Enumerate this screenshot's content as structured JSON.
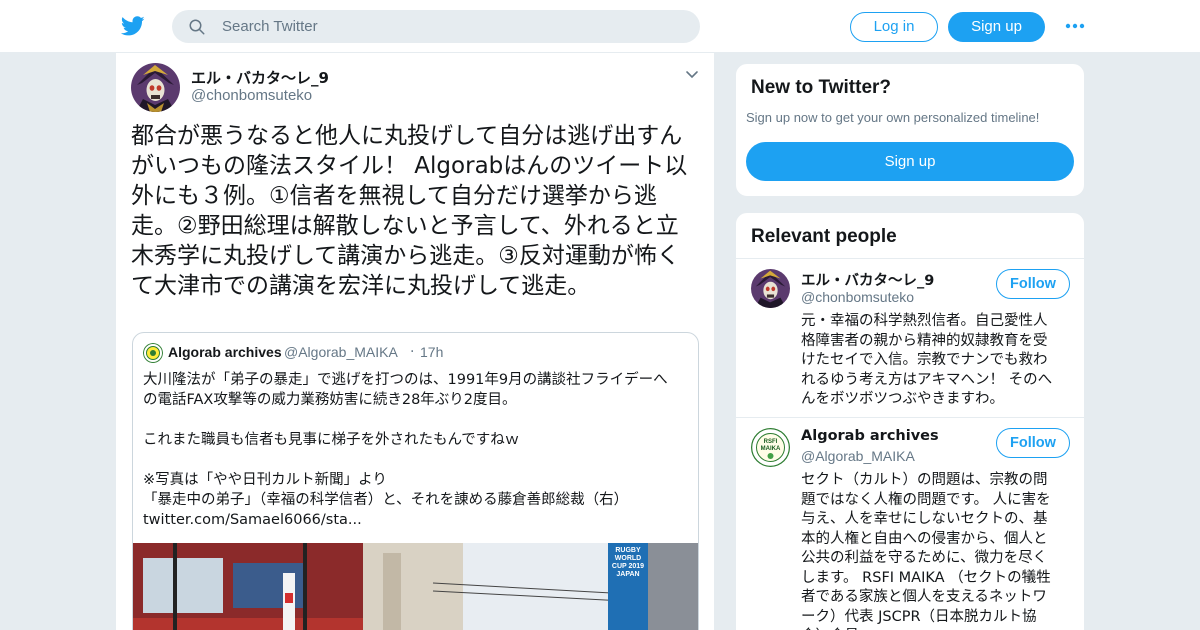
{
  "nav": {
    "search_placeholder": "Search Twitter",
    "login_label": "Log in",
    "signup_label": "Sign up",
    "more_icon": "more-dots-icon"
  },
  "tweet": {
    "author_name": "エル・バカタ～レ_9",
    "author_handle": "@chonbomsuteko",
    "text": "都合が悪うなると他人に丸投げして自分は逃げ出すんがいつもの隆法スタイル！ Algorabはんのツイート以外にも３例。①信者を無視して自分だけ選挙から逃走。②野田総理は解散しないと予言して、外れると立木秀学に丸投げして講演から逃走。③反対運動が怖くて大津市での講演を宏洋に丸投げして逃走。",
    "quote": {
      "name": "Algorab archives",
      "handle": "@Algorab_MAIKA",
      "dot": "·",
      "time": "17h",
      "lines": [
        "大川隆法が「弟子の暴走」で逃げを打つのは、1991年9月の講談社フライデーへ",
        "の電話FAX攻撃等の威力業務妨害に続き28年ぶり2度目。",
        "",
        "これまた職員も信者も見事に梯子を外されたもんですねｗ",
        "",
        "※写真は「やや日刊カルト新聞」より",
        "「暴走中の弟子」（幸福の科学信者）と、それを諌める藤倉善郎総裁（右）",
        "twitter.com/Samael6066/sta..."
      ],
      "photo_banner": "RUGBY WORLD CUP 2019 JAPAN"
    }
  },
  "sidebar": {
    "new_title": "New to Twitter?",
    "new_sub": "Sign up now to get your own personalized timeline!",
    "new_signup": "Sign up",
    "relevant_title": "Relevant people",
    "people": [
      {
        "name": "エル・バカタ～レ_9",
        "handle": "@chonbomsuteko",
        "follow": "Follow",
        "bio": "元・幸福の科学熱烈信者。自己愛性人\n格障害者の親から精神的奴隷教育を受\nけたセイで入信。宗教でナンでも救わ\nれるゆう考え方はアキマヘン！ そのへ\nんをボツボツつぶやきますわ。"
      },
      {
        "name": "Algorab archives",
        "handle": "@Algorab_MAIKA",
        "follow": "Follow",
        "bio": "セクト（カルト）の問題は、宗教の問\n題ではなく人権の問題です。 人に害を\n与え、人を幸せにしないセクトの、基\n本的人権と自由への侵害から、個人と\n公共の利益を守るために、微力を尽く\nします。 RSFI MAIKA （セクトの犠牲\n者である家族と個人を支えるネットワ\nーク）代表 JSCPR（日本脱カルト協\n会）会員"
      }
    ]
  },
  "colors": {
    "accent": "#1da1f2",
    "background": "#e6ecf0",
    "secondary_text": "#657786"
  }
}
